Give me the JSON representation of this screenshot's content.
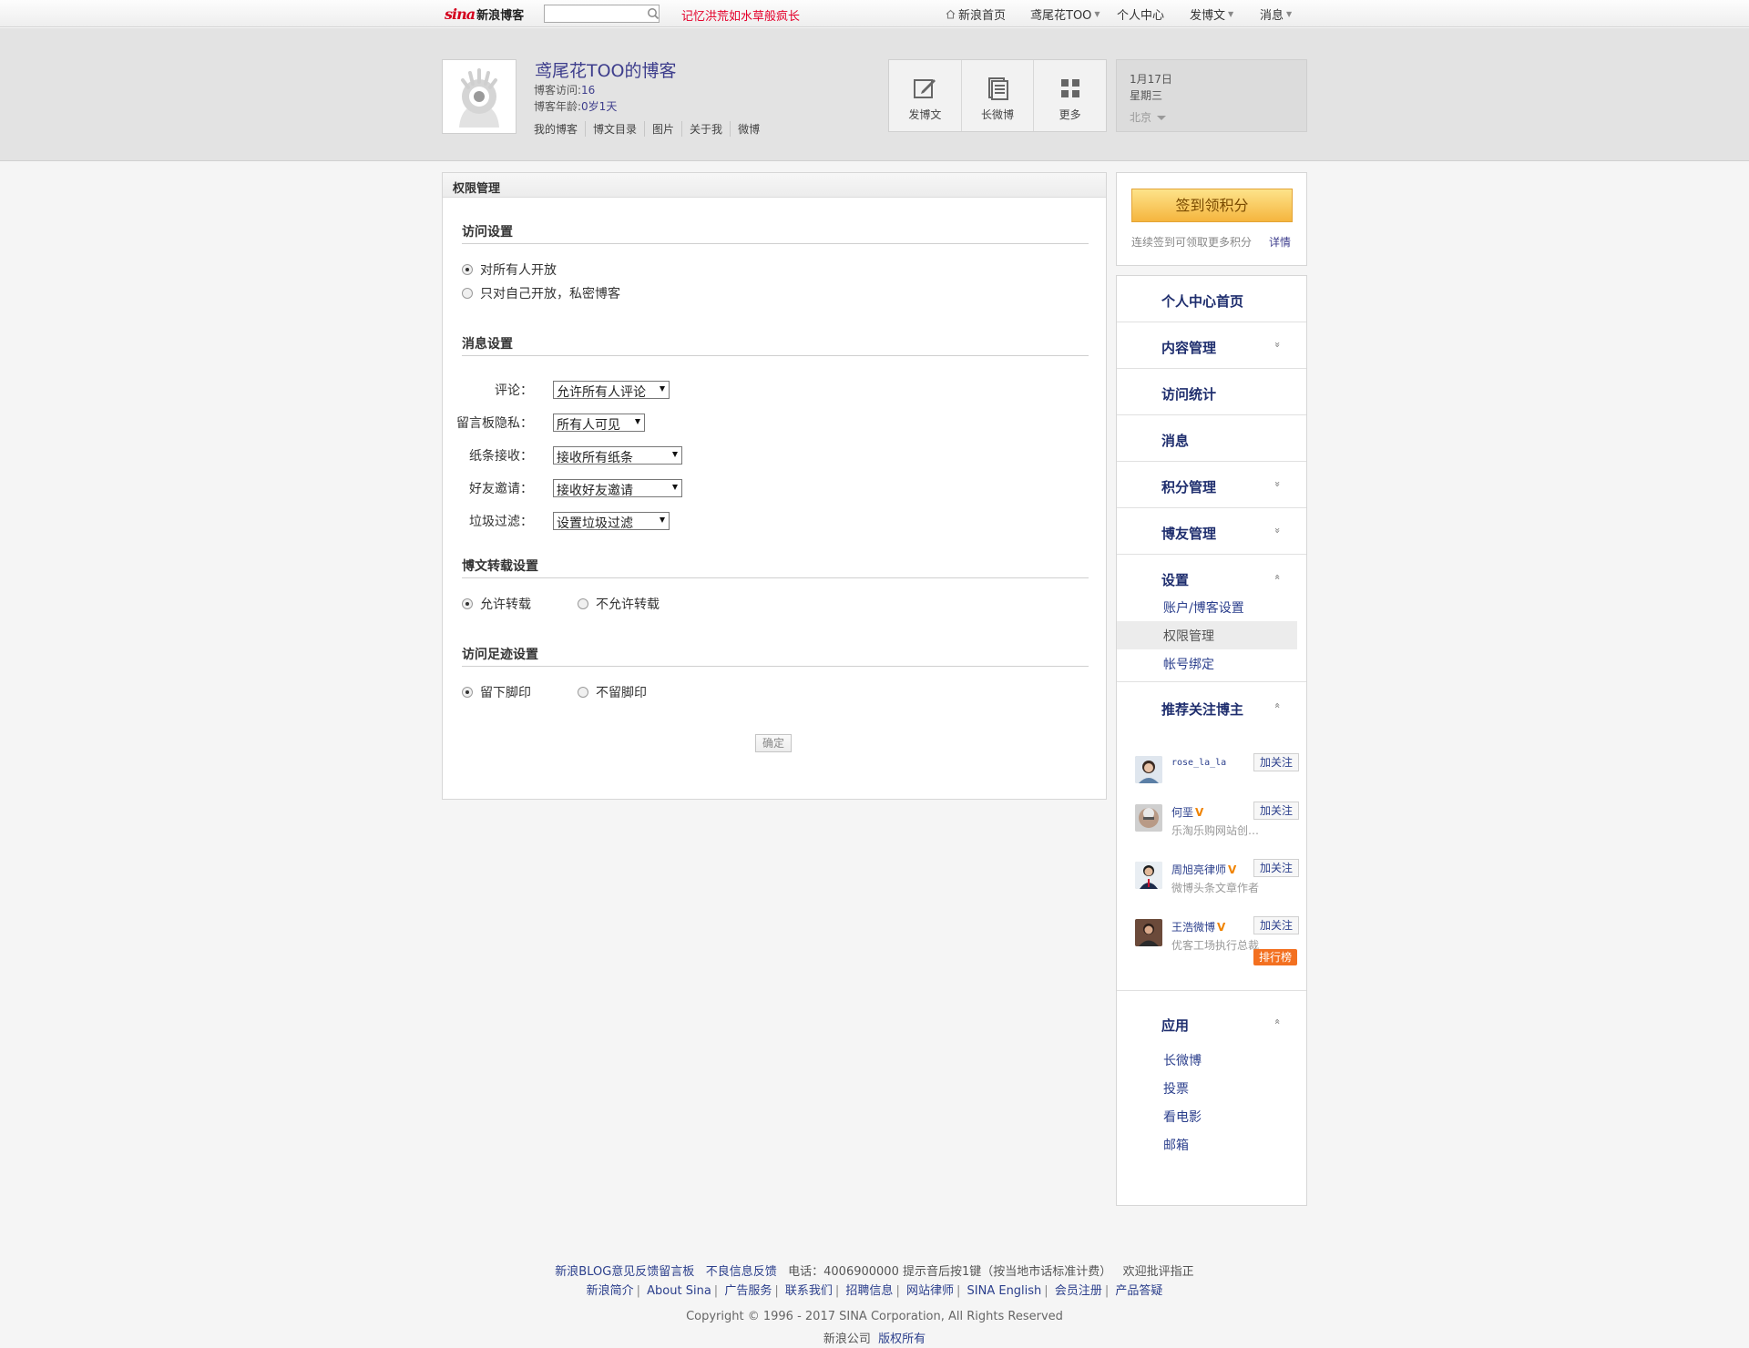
{
  "topnav": {
    "logo_mark": "sina",
    "logo_text": "新浪博客",
    "search_placeholder": "",
    "promo": "记忆洪荒如水草般疯长",
    "items": [
      {
        "label": "新浪首页",
        "icon": "home-icon"
      },
      {
        "label": "鸢尾花TOO",
        "caret": true
      },
      {
        "label": "个人中心"
      },
      {
        "label": "发博文",
        "caret": true
      },
      {
        "label": "消息",
        "caret": true
      }
    ]
  },
  "header": {
    "blog_title": "鸢尾花TOO的博客",
    "visits_label": "博客访问:",
    "visits_value": "16",
    "age_label": "博客年龄:",
    "age_value": "0岁1天",
    "links": [
      "我的博客",
      "博文目录",
      "图片",
      "关于我",
      "微博"
    ],
    "tools": [
      {
        "label": "发博文",
        "icon": "edit-icon"
      },
      {
        "label": "长微博",
        "icon": "long-weibo-icon"
      },
      {
        "label": "更多",
        "icon": "grid-icon"
      }
    ],
    "date": "1月17日",
    "weekday": "星期三",
    "city": "北京"
  },
  "main": {
    "title": "权限管理",
    "access": {
      "title": "访问设置",
      "options": [
        "对所有人开放",
        "只对自己开放，私密博客"
      ],
      "selected": 0
    },
    "message": {
      "title": "消息设置",
      "rows": [
        {
          "label": "评论：",
          "value": "允许所有人评论"
        },
        {
          "label": "留言板隐私：",
          "value": "所有人可见"
        },
        {
          "label": "纸条接收：",
          "value": "接收所有纸条"
        },
        {
          "label": "好友邀请：",
          "value": "接收好友邀请"
        },
        {
          "label": "垃圾过滤：",
          "value": "设置垃圾过滤"
        }
      ]
    },
    "repost": {
      "title": "博文转载设置",
      "options": [
        "允许转载",
        "不允许转载"
      ],
      "selected": 0
    },
    "footprint": {
      "title": "访问足迹设置",
      "options": [
        "留下脚印",
        "不留脚印"
      ],
      "selected": 0
    },
    "confirm": "确定"
  },
  "sidebar": {
    "sign": {
      "button": "签到领积分",
      "note": "连续签到可领取更多积分",
      "detail": "详情"
    },
    "menu": [
      {
        "label": "个人中心首页"
      },
      {
        "label": "内容管理",
        "chevron": "»"
      },
      {
        "label": "访问统计"
      },
      {
        "label": "消息"
      },
      {
        "label": "积分管理",
        "chevron": "»"
      },
      {
        "label": "博友管理",
        "chevron": "»"
      }
    ],
    "settings": {
      "label": "设置",
      "chevron": "«",
      "subs": [
        "账户/博客设置",
        "权限管理",
        "帐号绑定"
      ],
      "active": 1
    },
    "recommend": {
      "title": "推荐关注博主",
      "chevron": "«",
      "follow_label": "加关注",
      "users": [
        {
          "name": "rose_la_la",
          "verified": false,
          "desc": ""
        },
        {
          "name": "何垩",
          "verified": true,
          "desc": "乐淘乐购网站创始人..."
        },
        {
          "name": "周旭亮律师",
          "verified": true,
          "desc": "微博头条文章作者"
        },
        {
          "name": "王浩微博",
          "verified": true,
          "desc": "优客工场执行总裁"
        }
      ],
      "verified_mark": "V",
      "rank": "排行榜"
    },
    "apps": {
      "title": "应用",
      "chevron": "«",
      "items": [
        "长微博",
        "投票",
        "看电影",
        "邮箱"
      ]
    }
  },
  "footer": {
    "line1": {
      "links": [
        "新浪BLOG意见反馈留言板",
        "不良信息反馈"
      ],
      "phone": "电话：4006900000 提示音后按1键（按当地市话标准计费）",
      "welcome": "欢迎批评指正"
    },
    "line2": [
      "新浪简介",
      "About Sina",
      "广告服务",
      "联系我们",
      "招聘信息",
      "网站律师",
      "SINA English",
      "会员注册",
      "产品答疑"
    ],
    "copyright": "Copyright © 1996 - 2017 SINA Corporation, All Rights Reserved",
    "company": "新浪公司",
    "rights": "版权所有"
  }
}
